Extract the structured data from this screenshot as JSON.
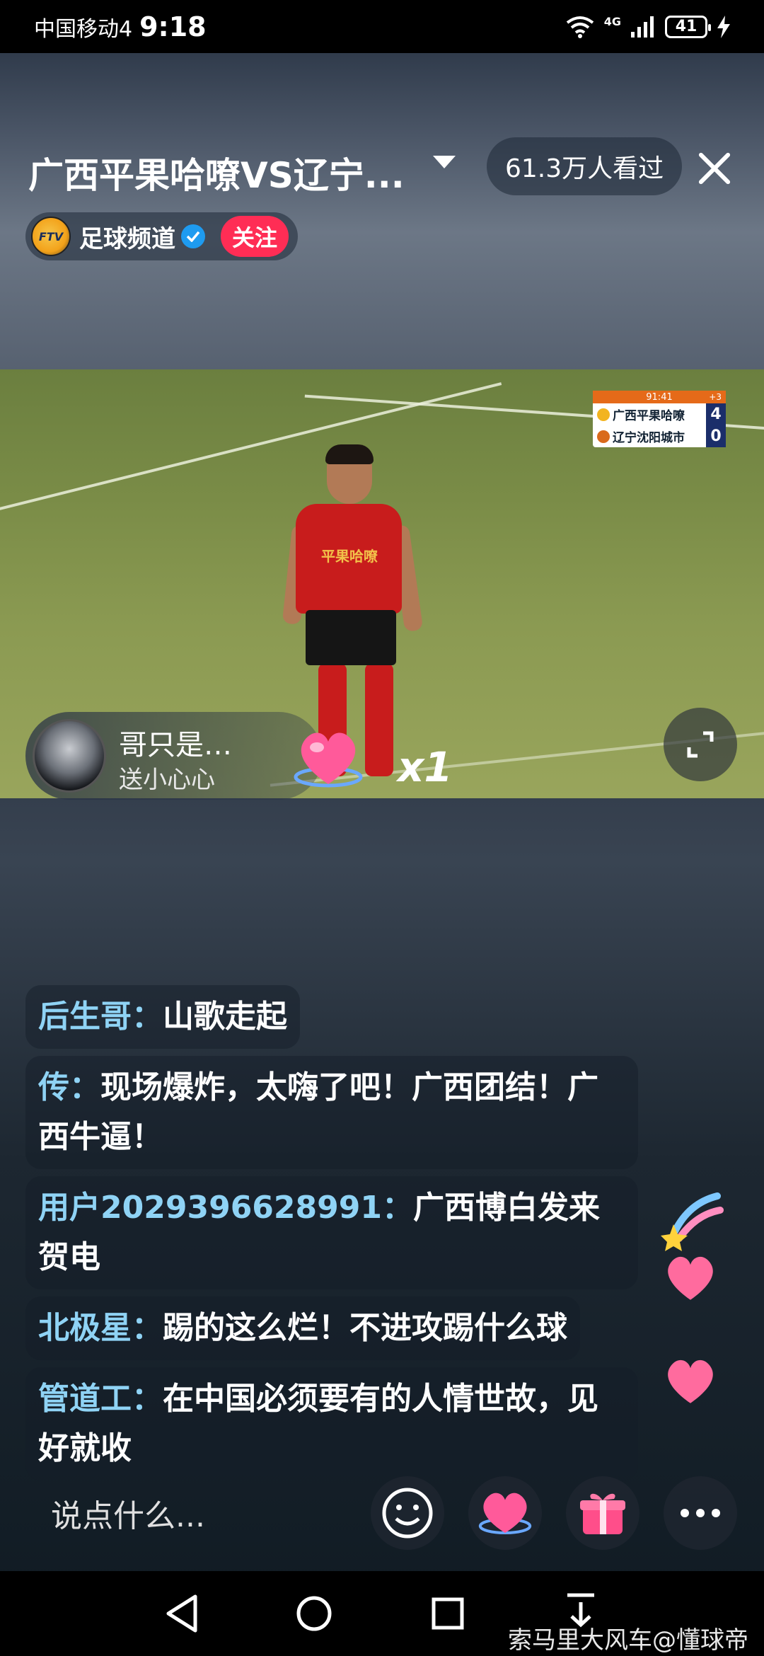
{
  "status_bar": {
    "carrier": "中国移动4",
    "time": "9:18",
    "network": "4G",
    "battery": "41"
  },
  "header": {
    "title": "广西平果哈嘹VS辽宁...",
    "viewers": "61.3万人看过"
  },
  "channel": {
    "logo_text": "FTV",
    "name": "足球频道",
    "follow_label": "关注"
  },
  "scoreboard": {
    "clock": "91:41",
    "added_time": "+3",
    "home_team": "广西平果哈嘹",
    "home_score": "4",
    "away_team": "辽宁沈阳城市",
    "away_score": "0"
  },
  "player": {
    "shirt_text": "平果哈嘹"
  },
  "gift": {
    "sender": "哥只是…",
    "action": "送小心心",
    "count": "x1"
  },
  "chat": [
    {
      "user": "后生哥：",
      "text": "山歌走起"
    },
    {
      "user": "传：",
      "text": "现场爆炸，太嗨了吧！广西团结！广西牛逼！"
    },
    {
      "user": "用户2029396628991：",
      "text": "广西博白发来贺电"
    },
    {
      "user": "北极星：",
      "text": "踢的这么烂！不进攻踢什么球"
    },
    {
      "user": "管道工：",
      "text": "在中国必须要有的人情世故，见好就收"
    }
  ],
  "input": {
    "placeholder": "说点什么..."
  },
  "watermark": "索马里大风车@懂球帝",
  "colors": {
    "follow": "#ff2d55",
    "username": "#8fd3f5",
    "gift_pink": "#ff5a9a"
  }
}
